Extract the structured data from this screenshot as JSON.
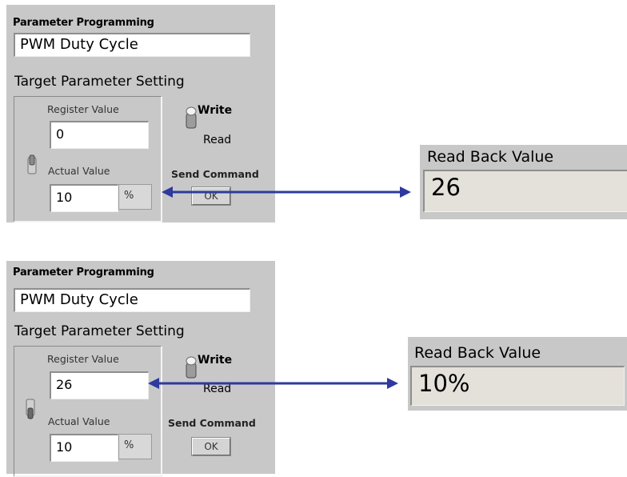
{
  "top_panel": {
    "title": "Parameter Programming",
    "parameter_name": "PWM Duty Cycle",
    "section_label": "Target Parameter Setting",
    "register_label": "Register Value",
    "register_value": "0",
    "actual_label": "Actual Value",
    "actual_value": "10",
    "unit": "%",
    "write_label": "Write",
    "read_label": "Read",
    "send_label": "Send Command",
    "ok_label": "OK"
  },
  "top_readback": {
    "title": "Read Back Value",
    "value": "26"
  },
  "bottom_panel": {
    "title": "Parameter Programming",
    "parameter_name": "PWM Duty Cycle",
    "section_label": "Target Parameter Setting",
    "register_label": "Register Value",
    "register_value": "26",
    "actual_label": "Actual Value",
    "actual_value": "10",
    "unit": "%",
    "write_label": "Write",
    "read_label": "Read",
    "send_label": "Send Command",
    "ok_label": "OK"
  },
  "bottom_readback": {
    "title": "Read Back Value",
    "value": "10%"
  },
  "colors": {
    "panel_bg": "#c8c8c8",
    "arrow": "#2e3a9e",
    "readback_bg": "#e4e0da"
  }
}
